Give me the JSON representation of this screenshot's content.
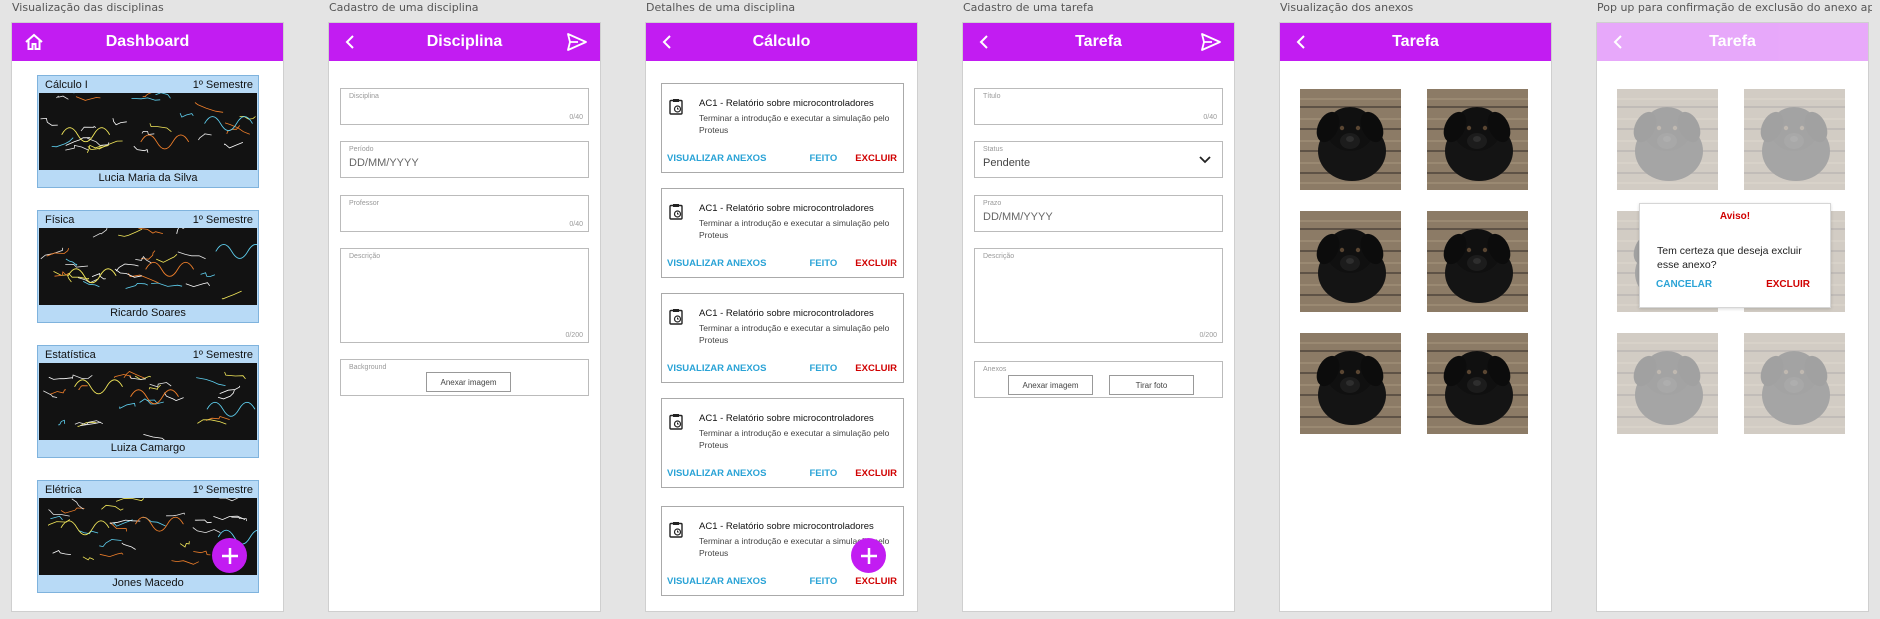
{
  "labels": [
    "Visualização das disciplinas",
    "Cadastro de uma disciplina",
    "Detalhes de uma disciplina",
    "Cadastro de uma tarefa",
    "Visualização dos anexos",
    "Pop up para confirmação de exclusão do anexo após L..."
  ],
  "colors": {
    "accent": "#c21cf2",
    "link": "#2aa3d6",
    "danger": "#d00000",
    "card": "#b8daf6"
  },
  "dashboard": {
    "title": "Dashboard",
    "icon": "home-icon",
    "subjects": [
      {
        "name": "Cálculo I",
        "semester": "1º Semestre",
        "teacher": "Lucia Maria da Silva"
      },
      {
        "name": "Física",
        "semester": "1º Semestre",
        "teacher": "Ricardo Soares"
      },
      {
        "name": "Estatística",
        "semester": "1º Semestre",
        "teacher": "Luiza Camargo"
      },
      {
        "name": "Elétrica",
        "semester": "1º Semestre",
        "teacher": "Jones Macedo"
      }
    ]
  },
  "disciplina": {
    "title": "Disciplina",
    "fields": {
      "disciplina": {
        "label": "Disciplina",
        "counter": "0/40"
      },
      "periodo": {
        "label": "Período",
        "placeholder": "DD/MM/YYYY"
      },
      "professor": {
        "label": "Professor",
        "counter": "0/40"
      },
      "descricao": {
        "label": "Descrição",
        "counter": "0/200"
      },
      "background": {
        "label": "Background",
        "button": "Anexar imagem"
      }
    }
  },
  "calculo": {
    "title": "Cálculo",
    "tasks": [
      {
        "title": "AC1 - Relatório sobre microcontroladores",
        "desc": "Terminar a introdução e executar a simulação pelo Proteus"
      },
      {
        "title": "AC1 - Relatório sobre microcontroladores",
        "desc": "Terminar a introdução e executar a simulação pelo Proteus"
      },
      {
        "title": "AC1 - Relatório sobre microcontroladores",
        "desc": "Terminar a introdução e executar a simulação pelo Proteus"
      },
      {
        "title": "AC1 - Relatório sobre microcontroladores",
        "desc": "Terminar a introdução e executar a simulação pelo Proteus"
      },
      {
        "title": "AC1 - Relatório sobre microcontroladores",
        "desc": "Terminar a introdução e executar a simulação pelo Proteus"
      }
    ],
    "actions": {
      "view": "VISUALIZAR ANEXOS",
      "done": "FEITO",
      "delete": "EXCLUIR"
    }
  },
  "tarefa": {
    "title": "Tarefa",
    "fields": {
      "titulo": {
        "label": "Título",
        "counter": "0/40"
      },
      "status": {
        "label": "Status",
        "value": "Pendente"
      },
      "prazo": {
        "label": "Prazo",
        "placeholder": "DD/MM/YYYY"
      },
      "descricao": {
        "label": "Descrição",
        "counter": "0/200"
      },
      "anexos": {
        "label": "Anexos",
        "button1": "Anexar imagem",
        "button2": "Tirar foto"
      }
    }
  },
  "anexos": {
    "title": "Tarefa"
  },
  "popup": {
    "title": "Tarefa",
    "dialog_title": "Aviso!",
    "dialog_message": "Tem certeza que deseja excluir esse anexo?",
    "cancel": "CANCELAR",
    "confirm": "EXCLUIR"
  }
}
